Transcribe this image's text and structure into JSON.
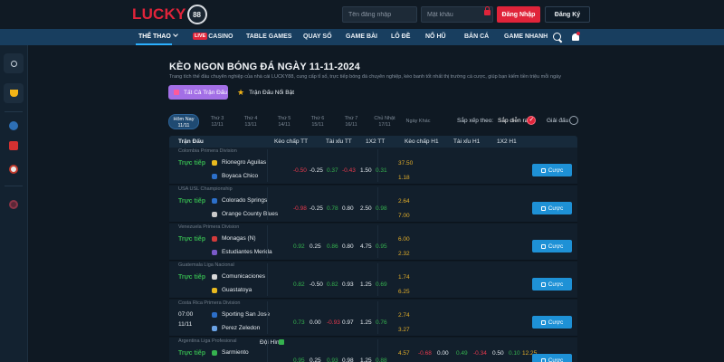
{
  "header": {
    "logo_text": "LUCKY",
    "logo_badge": "88",
    "username_placeholder": "Tên đăng nhập",
    "password_placeholder": "Mật khẩu",
    "login_label": "Đăng Nhập",
    "register_label": "Đăng Ký"
  },
  "nav": {
    "items": [
      "THỂ THAO",
      "CASINO",
      "TABLE GAMES",
      "QUAY SỐ",
      "GAME BÀI",
      "LÔ ĐỀ",
      "NỔ HŨ",
      "BẮN CÁ",
      "GAME NHANH"
    ],
    "live_badge": "LIVE"
  },
  "page": {
    "title": "KÈO NGON BÓNG ĐÁ NGÀY 11-11-2024",
    "description": "Trang tích thế đầu chuyên nghiệp của nhà cái LUCKY88, cung cấp tỉ số, trực tiếp bóng đá chuyên nghiệp, kèo banh tốt nhất thị trường cá cược, giúp bạn kiếm tiền triệu mỗi ngày",
    "btn_all": "Tất Cả Trận Đấu",
    "btn_featured": "Trận Đấu Nổi Bật"
  },
  "dates": [
    {
      "day": "Hôm Nay",
      "date": "11/11"
    },
    {
      "day": "Thứ 3",
      "date": "12/11"
    },
    {
      "day": "Thứ 4",
      "date": "13/11"
    },
    {
      "day": "Thứ 5",
      "date": "14/11"
    },
    {
      "day": "Thứ 6",
      "date": "15/11"
    },
    {
      "day": "Thứ 7",
      "date": "16/11"
    },
    {
      "day": "Chủ Nhật",
      "date": "17/11"
    },
    {
      "day": "Ngày Khác",
      "date": ""
    }
  ],
  "sort": {
    "label": "Sắp xếp theo:",
    "option1": "Sắp diễn ra",
    "option2": "Giải đấu"
  },
  "table_headers": [
    "Trận Đấu",
    "Kèo chấp TT",
    "Tài xỉu TT",
    "1X2 TT",
    "Kèo chấp H1",
    "Tài xỉu H1",
    "1X2 H1"
  ],
  "bet_label": "Cược",
  "matches": [
    {
      "league": "Colombia Primera Division",
      "status": "Trực tiếp",
      "time": "",
      "date": "",
      "extra": "",
      "home": "Rionegro Aguilas",
      "away": "Boyaca Chico",
      "ft_hdp": "-0.50",
      "ft_hdp_odds": "-0.25",
      "ft_ou": "0.37",
      "ft_ou_odds": "-0.43",
      "ft_1x2": "1.50",
      "ft_1x2_b": "0.31",
      "h1_top": "37.50",
      "h1_bottom": "1.18",
      "h1_hdp": "",
      "h1_hdp_odds": "",
      "h1_ou": "",
      "h1_ou_odds": "",
      "h1_1x2": "",
      "h1_1x2_b": ""
    },
    {
      "league": "USA USL Championship",
      "status": "Trực tiếp",
      "time": "",
      "date": "",
      "extra": "",
      "home": "Colorado Springs",
      "away": "Orange County Blues",
      "ft_hdp": "-0.98",
      "ft_hdp_odds": "-0.25",
      "ft_ou": "0.78",
      "ft_ou_odds": "0.80",
      "ft_1x2": "2.50",
      "ft_1x2_b": "0.98",
      "h1_top": "2.64",
      "h1_bottom": "7.00",
      "h1_hdp": "",
      "h1_hdp_odds": "",
      "h1_ou": "",
      "h1_ou_odds": "",
      "h1_1x2": "",
      "h1_1x2_b": ""
    },
    {
      "league": "Venezuela Primera Division",
      "status": "Trực tiếp",
      "time": "",
      "date": "",
      "extra": "",
      "home": "Monagas (N)",
      "away": "Estudiantes Merida",
      "ft_hdp": "0.92",
      "ft_hdp_odds": "0.25",
      "ft_ou": "0.86",
      "ft_ou_odds": "0.80",
      "ft_1x2": "4.75",
      "ft_1x2_b": "0.95",
      "h1_top": "6.00",
      "h1_bottom": "2.32",
      "h1_hdp": "",
      "h1_hdp_odds": "",
      "h1_ou": "",
      "h1_ou_odds": "",
      "h1_1x2": "",
      "h1_1x2_b": ""
    },
    {
      "league": "Guatemala Liga Nacional",
      "status": "Trực tiếp",
      "time": "",
      "date": "",
      "extra": "",
      "home": "Comunicaciones",
      "away": "Guastatoya",
      "ft_hdp": "0.82",
      "ft_hdp_odds": "-0.50",
      "ft_ou": "0.82",
      "ft_ou_odds": "0.93",
      "ft_1x2": "1.25",
      "ft_1x2_b": "0.69",
      "h1_top": "1.74",
      "h1_bottom": "6.25",
      "h1_hdp": "",
      "h1_hdp_odds": "",
      "h1_ou": "",
      "h1_ou_odds": "",
      "h1_1x2": "",
      "h1_1x2_b": ""
    },
    {
      "league": "Costa Rica Primera Division",
      "status": "",
      "time": "07:00",
      "date": "11/11",
      "extra": "",
      "home": "Sporting San Jose",
      "away": "Perez Zeledon",
      "ft_hdp": "0.73",
      "ft_hdp_odds": "0.00",
      "ft_ou": "-0.93",
      "ft_ou_odds": "0.97",
      "ft_1x2": "1.25",
      "ft_1x2_b": "0.76",
      "h1_top": "2.74",
      "h1_bottom": "3.27",
      "h1_hdp": "",
      "h1_hdp_odds": "",
      "h1_ou": "",
      "h1_ou_odds": "",
      "h1_1x2": "",
      "h1_1x2_b": ""
    },
    {
      "league": "Argentina Liga Profesional",
      "status": "Trực tiếp",
      "time": "",
      "date": "",
      "extra": "Đội Hình",
      "home": "Sarmiento",
      "away": "",
      "ft_hdp": "0.95",
      "ft_hdp_odds": "0.25",
      "ft_ou": "0.93",
      "ft_ou_odds": "0.98",
      "ft_1x2": "1.25",
      "ft_1x2_b": "0.88",
      "h1_top": "4.57",
      "h1_bottom": "",
      "h1_hdp": "-0.68",
      "h1_hdp_odds": "0.00",
      "h1_ou": "0.49",
      "h1_ou_odds": "-0.34",
      "h1_1x2": "0.50",
      "h1_1x2_b": "0.10",
      "h1_extra": "12.25"
    }
  ]
}
